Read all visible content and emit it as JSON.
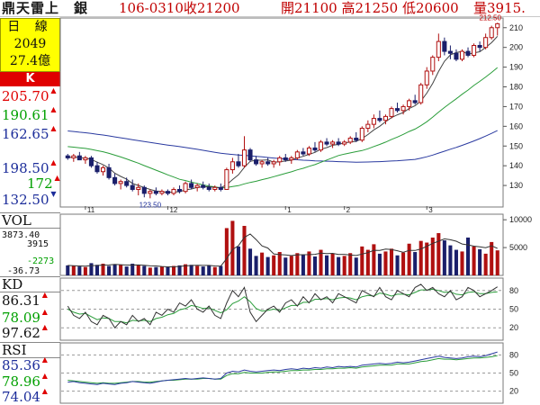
{
  "header": {
    "stock": "鼎天雷上　銀",
    "meta": "106-0310收21200",
    "quote": "開21100 高21250 低20600",
    "volume": "量3915."
  },
  "info": {
    "period": "日 線",
    "code": "2049",
    "amount": "27.4億"
  },
  "k_panel": {
    "title": "K",
    "upper_labels": [
      "205.70",
      "190.61",
      "162.65"
    ],
    "lower_labels": [
      "198.50",
      "172",
      "132.50"
    ],
    "axis_ticks": [
      210,
      200,
      190,
      180,
      170,
      160,
      150,
      140,
      130
    ],
    "high_mark": "212.50",
    "low_mark": "123.50",
    "months": [
      "11",
      "12",
      "1",
      "2",
      "3"
    ]
  },
  "vol_panel": {
    "title": "VOL",
    "value1": "3873.40",
    "value2": "3915",
    "value3": "-2273",
    "value4": "-36.73",
    "axis_ticks": [
      10000,
      5000
    ]
  },
  "kd_panel": {
    "title": "KD",
    "values": [
      "86.31",
      "78.09",
      "97.62"
    ],
    "axis_ticks": [
      80,
      50,
      20
    ]
  },
  "rsi_panel": {
    "title": "RSI",
    "values": [
      "85.36",
      "78.96",
      "74.04"
    ],
    "axis_ticks": [
      80,
      50,
      20
    ]
  },
  "colors": {
    "up": "#b01010",
    "down": "#1a1f6b",
    "ma_green": "#2a9d3a",
    "ma_blue": "#2a3aa0",
    "header_red": "#c00000",
    "label_yellow": "#ffff00"
  },
  "series": {
    "candles": [
      [
        145,
        146,
        143,
        144
      ],
      [
        144,
        146,
        142,
        145
      ],
      [
        145,
        147,
        143,
        143
      ],
      [
        143,
        145,
        141,
        144
      ],
      [
        144,
        145,
        139,
        140
      ],
      [
        140,
        142,
        136,
        137
      ],
      [
        137,
        140,
        135,
        139
      ],
      [
        139,
        141,
        133,
        134
      ],
      [
        134,
        136,
        130,
        131
      ],
      [
        131,
        133,
        128,
        132
      ],
      [
        132,
        134,
        129,
        130
      ],
      [
        130,
        133,
        127,
        128
      ],
      [
        128,
        131,
        125,
        129
      ],
      [
        129,
        130,
        124,
        126
      ],
      [
        126,
        128,
        123.5,
        127
      ],
      [
        127,
        129,
        125,
        126
      ],
      [
        126,
        128,
        125,
        127
      ],
      [
        127,
        128,
        125,
        126
      ],
      [
        126,
        129,
        125,
        128
      ],
      [
        128,
        130,
        126,
        127
      ],
      [
        127,
        132,
        126,
        131
      ],
      [
        131,
        133,
        128,
        129
      ],
      [
        129,
        131,
        127,
        130
      ],
      [
        130,
        132,
        128,
        129
      ],
      [
        129,
        131,
        127,
        128
      ],
      [
        128,
        130,
        127,
        129
      ],
      [
        129,
        131,
        127,
        128
      ],
      [
        128,
        139,
        128,
        138
      ],
      [
        138,
        144,
        136,
        142
      ],
      [
        142,
        146,
        139,
        140
      ],
      [
        140,
        155,
        139,
        148
      ],
      [
        148,
        149,
        142,
        143
      ],
      [
        143,
        145,
        140,
        141
      ],
      [
        141,
        143,
        139,
        142
      ],
      [
        142,
        144,
        140,
        141
      ],
      [
        141,
        143,
        139,
        142
      ],
      [
        142,
        145,
        140,
        144
      ],
      [
        144,
        146,
        142,
        143
      ],
      [
        143,
        145,
        141,
        144
      ],
      [
        144,
        148,
        143,
        147
      ],
      [
        147,
        149,
        145,
        146
      ],
      [
        146,
        150,
        145,
        149
      ],
      [
        149,
        152,
        147,
        148
      ],
      [
        148,
        153,
        147,
        152
      ],
      [
        152,
        154,
        150,
        151
      ],
      [
        151,
        153,
        149,
        152
      ],
      [
        152,
        154,
        150,
        151
      ],
      [
        151,
        153,
        150,
        152
      ],
      [
        152,
        155,
        151,
        154
      ],
      [
        154,
        157,
        152,
        153
      ],
      [
        153,
        160,
        152,
        159
      ],
      [
        159,
        163,
        157,
        161
      ],
      [
        161,
        166,
        159,
        164
      ],
      [
        164,
        168,
        162,
        163
      ],
      [
        163,
        166,
        161,
        165
      ],
      [
        165,
        170,
        164,
        169
      ],
      [
        169,
        172,
        167,
        168
      ],
      [
        168,
        171,
        166,
        170
      ],
      [
        170,
        174,
        168,
        173
      ],
      [
        173,
        176,
        171,
        172
      ],
      [
        172,
        182,
        171,
        181
      ],
      [
        181,
        190,
        179,
        188
      ],
      [
        188,
        196,
        186,
        195
      ],
      [
        195,
        207,
        193,
        203
      ],
      [
        203,
        205,
        196,
        198
      ],
      [
        198,
        201,
        194,
        197
      ],
      [
        197,
        199,
        193,
        194
      ],
      [
        194,
        199,
        193,
        198
      ],
      [
        198,
        200,
        195,
        196
      ],
      [
        196,
        202,
        195,
        201
      ],
      [
        201,
        203,
        198,
        200
      ],
      [
        200,
        207,
        199,
        205
      ],
      [
        205,
        211,
        204,
        210
      ],
      [
        210,
        212.5,
        206,
        212
      ]
    ],
    "volume": [
      1800,
      1700,
      1600,
      1500,
      2200,
      1900,
      2100,
      1700,
      2000,
      1900,
      1600,
      2100,
      1800,
      1700,
      1400,
      1500,
      1600,
      1500,
      1700,
      1800,
      2000,
      1900,
      1700,
      1600,
      1800,
      1500,
      1700,
      8500,
      9800,
      5200,
      8900,
      4800,
      3500,
      4100,
      3300,
      3600,
      4200,
      3200,
      3500,
      4000,
      3700,
      4300,
      3400,
      4600,
      3600,
      3900,
      3300,
      3500,
      4000,
      3200,
      5200,
      4600,
      5600,
      3900,
      4300,
      4800,
      3600,
      4100,
      5700,
      4200,
      6200,
      5900,
      6800,
      7600,
      6300,
      5400,
      4600,
      4300,
      6800,
      5200,
      4700,
      3900,
      6000,
      4500
    ],
    "k": [
      55,
      40,
      35,
      45,
      30,
      25,
      40,
      35,
      20,
      30,
      25,
      40,
      30,
      35,
      25,
      45,
      40,
      50,
      45,
      60,
      55,
      65,
      50,
      45,
      55,
      40,
      35,
      60,
      80,
      70,
      85,
      45,
      30,
      40,
      50,
      55,
      45,
      60,
      65,
      55,
      70,
      60,
      75,
      65,
      70,
      60,
      75,
      70,
      65,
      60,
      80,
      75,
      70,
      85,
      70,
      65,
      80,
      75,
      70,
      85,
      90,
      80,
      85,
      75,
      70,
      80,
      65,
      70,
      85,
      80,
      70,
      75,
      80,
      86
    ],
    "d": [
      50,
      45,
      42,
      43,
      38,
      33,
      36,
      35,
      30,
      30,
      28,
      32,
      31,
      32,
      30,
      35,
      37,
      41,
      43,
      49,
      51,
      56,
      54,
      51,
      52,
      48,
      44,
      49,
      59,
      63,
      70,
      62,
      51,
      47,
      48,
      50,
      48,
      52,
      56,
      56,
      61,
      61,
      66,
      66,
      67,
      65,
      68,
      69,
      68,
      65,
      70,
      72,
      71,
      76,
      74,
      71,
      74,
      74,
      73,
      77,
      81,
      81,
      82,
      80,
      77,
      78,
      74,
      73,
      77,
      78,
      75,
      75,
      77,
      78
    ],
    "rsi1": [
      35,
      36,
      34,
      33,
      32,
      31,
      33,
      32,
      31,
      33,
      34,
      36,
      35,
      34,
      33,
      35,
      37,
      38,
      39,
      40,
      41,
      40,
      41,
      42,
      41,
      40,
      41,
      50,
      53,
      52,
      55,
      53,
      52,
      53,
      54,
      55,
      54,
      56,
      57,
      56,
      58,
      57,
      59,
      58,
      60,
      59,
      61,
      60,
      61,
      60,
      63,
      64,
      65,
      66,
      65,
      66,
      68,
      67,
      68,
      70,
      72,
      74,
      76,
      78,
      76,
      75,
      74,
      75,
      77,
      78,
      77,
      79,
      82,
      85
    ],
    "rsi2": [
      38,
      37,
      36,
      35,
      34,
      33,
      34,
      33,
      33,
      34,
      35,
      36,
      36,
      35,
      35,
      36,
      37,
      38,
      38,
      39,
      40,
      40,
      40,
      41,
      41,
      40,
      40,
      46,
      49,
      49,
      51,
      50,
      50,
      50,
      51,
      52,
      52,
      53,
      54,
      54,
      55,
      55,
      56,
      56,
      57,
      57,
      58,
      58,
      59,
      58,
      60,
      61,
      62,
      63,
      63,
      63,
      65,
      65,
      65,
      67,
      69,
      70,
      72,
      74,
      73,
      73,
      72,
      73,
      74,
      75,
      75,
      76,
      77,
      79
    ]
  }
}
